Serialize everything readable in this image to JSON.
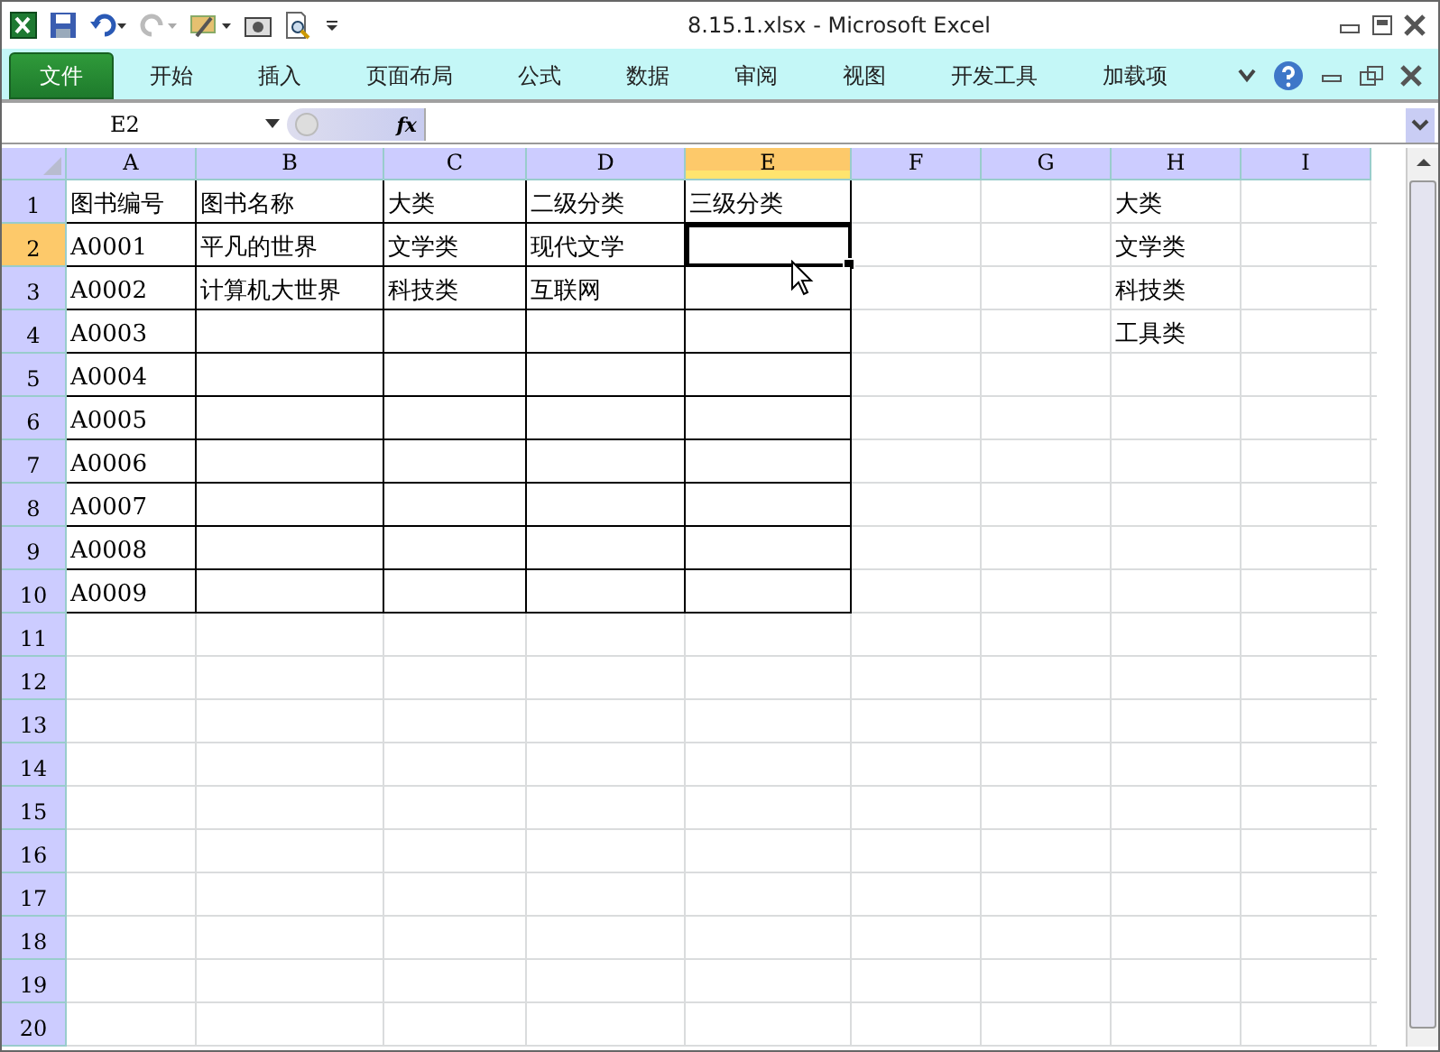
{
  "window": {
    "title": "8.15.1.xlsx  -  Microsoft Excel"
  },
  "ribbon_tabs": [
    {
      "label": "文件",
      "selected": true
    },
    {
      "label": "开始",
      "selected": false
    },
    {
      "label": "插入",
      "selected": false
    },
    {
      "label": "页面布局",
      "selected": false
    },
    {
      "label": "公式",
      "selected": false
    },
    {
      "label": "数据",
      "selected": false
    },
    {
      "label": "审阅",
      "selected": false
    },
    {
      "label": "视图",
      "selected": false
    },
    {
      "label": "开发工具",
      "selected": false
    },
    {
      "label": "加载项",
      "selected": false
    }
  ],
  "formula_bar": {
    "name_box": "E2",
    "fx": "fx"
  },
  "columns": [
    {
      "label": "A",
      "selected": false
    },
    {
      "label": "B",
      "selected": false
    },
    {
      "label": "C",
      "selected": false
    },
    {
      "label": "D",
      "selected": false
    },
    {
      "label": "E",
      "selected": true
    },
    {
      "label": "F",
      "selected": false
    },
    {
      "label": "G",
      "selected": false
    },
    {
      "label": "H",
      "selected": false
    },
    {
      "label": "I",
      "selected": false
    }
  ],
  "rows": [
    {
      "number": "1",
      "selected": false,
      "bordered": true,
      "cells": [
        "图书编号",
        "图书名称",
        "大类",
        "二级分类",
        "三级分类",
        null,
        null,
        "大类",
        null
      ]
    },
    {
      "number": "2",
      "selected": true,
      "bordered": true,
      "cells": [
        "A0001",
        "平凡的世界",
        "文学类",
        "现代文学",
        null,
        null,
        null,
        "文学类",
        null
      ]
    },
    {
      "number": "3",
      "selected": false,
      "bordered": true,
      "cells": [
        "A0002",
        "计算机大世界",
        "科技类",
        "互联网",
        null,
        null,
        null,
        "科技类",
        null
      ]
    },
    {
      "number": "4",
      "selected": false,
      "bordered": true,
      "cells": [
        "A0003",
        null,
        null,
        null,
        null,
        null,
        null,
        "工具类",
        null
      ]
    },
    {
      "number": "5",
      "selected": false,
      "bordered": true,
      "cells": [
        "A0004"
      ]
    },
    {
      "number": "6",
      "selected": false,
      "bordered": true,
      "cells": [
        "A0005"
      ]
    },
    {
      "number": "7",
      "selected": false,
      "bordered": true,
      "cells": [
        "A0006"
      ]
    },
    {
      "number": "8",
      "selected": false,
      "bordered": true,
      "cells": [
        "A0007"
      ]
    },
    {
      "number": "9",
      "selected": false,
      "bordered": true,
      "cells": [
        "A0008"
      ]
    },
    {
      "number": "10",
      "selected": false,
      "bordered": true,
      "cells": [
        "A0009"
      ]
    },
    {
      "number": "11",
      "selected": false,
      "bordered": false
    },
    {
      "number": "12",
      "selected": false,
      "bordered": false
    },
    {
      "number": "13",
      "selected": false,
      "bordered": false
    },
    {
      "number": "14",
      "selected": false,
      "bordered": false
    },
    {
      "number": "15",
      "selected": false,
      "bordered": false
    },
    {
      "number": "16",
      "selected": false,
      "bordered": false
    },
    {
      "number": "17",
      "selected": false,
      "bordered": false
    },
    {
      "number": "18",
      "selected": false,
      "bordered": false
    },
    {
      "number": "19",
      "selected": false,
      "bordered": false
    },
    {
      "number": "20",
      "selected": false,
      "bordered": false
    }
  ]
}
